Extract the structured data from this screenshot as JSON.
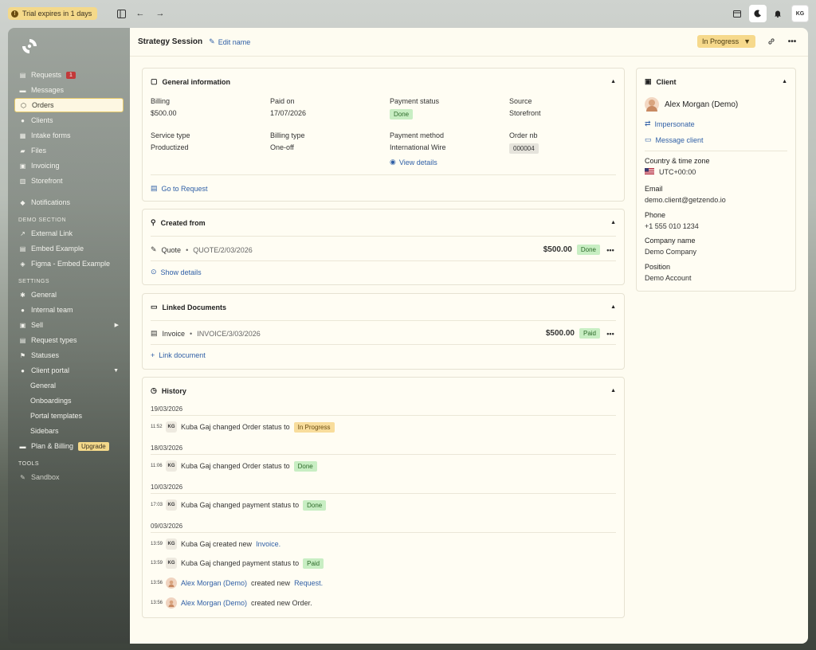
{
  "topbar": {
    "trial_text": "Trial expires in 1 days",
    "avatar_initials": "KG"
  },
  "sidebar": {
    "main_items": [
      {
        "label": "Requests",
        "icon": "inbox-icon",
        "badge": "1"
      },
      {
        "label": "Messages",
        "icon": "chat-icon"
      },
      {
        "label": "Orders",
        "icon": "box-icon",
        "active": true
      },
      {
        "label": "Clients",
        "icon": "users-icon"
      },
      {
        "label": "Intake forms",
        "icon": "form-icon"
      },
      {
        "label": "Files",
        "icon": "folder-icon"
      },
      {
        "label": "Invoicing",
        "icon": "invoice-icon"
      },
      {
        "label": "Storefront",
        "icon": "store-icon"
      }
    ],
    "notifications_label": "Notifications",
    "demo_section_title": "DEMO SECTION",
    "demo_items": [
      {
        "label": "External Link"
      },
      {
        "label": "Embed Example"
      },
      {
        "label": "Figma - Embed Example"
      }
    ],
    "settings_title": "SETTINGS",
    "settings_items": [
      {
        "label": "General"
      },
      {
        "label": "Internal team"
      },
      {
        "label": "Sell"
      },
      {
        "label": "Request types"
      },
      {
        "label": "Statuses"
      },
      {
        "label": "Client portal"
      }
    ],
    "client_portal_sub": [
      {
        "label": "General"
      },
      {
        "label": "Onboardings"
      },
      {
        "label": "Portal templates"
      },
      {
        "label": "Sidebars"
      }
    ],
    "plan_label": "Plan & Billing",
    "upgrade_label": "Upgrade",
    "tools_title": "TOOLS",
    "sandbox_label": "Sandbox"
  },
  "header": {
    "title": "Strategy Session",
    "edit_label": "Edit name",
    "status": "In Progress"
  },
  "general_info": {
    "title": "General information",
    "billing_label": "Billing",
    "billing_value": "$500.00",
    "paid_on_label": "Paid on",
    "paid_on_value": "17/07/2026",
    "payment_status_label": "Payment status",
    "payment_status_value": "Done",
    "source_label": "Source",
    "source_value": "Storefront",
    "service_type_label": "Service type",
    "service_type_value": "Productized",
    "billing_type_label": "Billing type",
    "billing_type_value": "One-off",
    "payment_method_label": "Payment method",
    "payment_method_value": "International Wire",
    "view_details": "View details",
    "order_nb_label": "Order nb",
    "order_nb_value": "000004",
    "go_to_request": "Go to Request"
  },
  "created_from": {
    "title": "Created from",
    "type": "Quote",
    "separator": "•",
    "ref": "QUOTE/2/03/2026",
    "amount": "$500.00",
    "status": "Done",
    "show_details": "Show details"
  },
  "linked_docs": {
    "title": "Linked Documents",
    "type": "Invoice",
    "separator": "•",
    "ref": "INVOICE/3/03/2026",
    "amount": "$500.00",
    "status": "Paid",
    "link_label": "Link document"
  },
  "history": {
    "title": "History",
    "groups": [
      {
        "date": "19/03/2026",
        "items": [
          {
            "time": "11:52",
            "actor": "KG",
            "text": "Kuba Gaj changed Order status to",
            "tag": "In Progress",
            "tag_color": "yellow"
          }
        ]
      },
      {
        "date": "18/03/2026",
        "items": [
          {
            "time": "11:06",
            "actor": "KG",
            "text": "Kuba Gaj changed Order status to",
            "tag": "Done",
            "tag_color": "green"
          }
        ]
      },
      {
        "date": "10/03/2026",
        "items": [
          {
            "time": "17:03",
            "actor": "KG",
            "text": "Kuba Gaj changed payment status to",
            "tag": "Done",
            "tag_color": "green"
          }
        ]
      },
      {
        "date": "09/03/2026",
        "items": [
          {
            "time": "13:59",
            "actor": "KG",
            "text": "Kuba Gaj created new",
            "link": "Invoice."
          },
          {
            "time": "13:59",
            "actor": "KG",
            "text": "Kuba Gaj changed payment status to",
            "tag": "Paid",
            "tag_color": "green"
          },
          {
            "time": "13:56",
            "actor": "avatar",
            "name": "Alex Morgan (Demo)",
            "text": "created new",
            "link": "Request."
          },
          {
            "time": "13:56",
            "actor": "avatar",
            "name": "Alex Morgan (Demo)",
            "text": "created new Order."
          }
        ]
      }
    ]
  },
  "client": {
    "title": "Client",
    "name": "Alex Morgan (Demo)",
    "impersonate": "Impersonate",
    "message": "Message client",
    "country_label": "Country & time zone",
    "country_value": "UTC+00:00",
    "email_label": "Email",
    "email_value": "demo.client@getzendo.io",
    "phone_label": "Phone",
    "phone_value": "+1 555 010 1234",
    "company_label": "Company name",
    "company_value": "Demo Company",
    "position_label": "Position",
    "position_value": "Demo Account"
  },
  "colors": {
    "accent_link": "#2f5fa6",
    "status_yellow": "#f6d98c",
    "status_green": "#c8eec3",
    "badge_red": "#c23a3a",
    "main_bg": "#fefcf1"
  }
}
